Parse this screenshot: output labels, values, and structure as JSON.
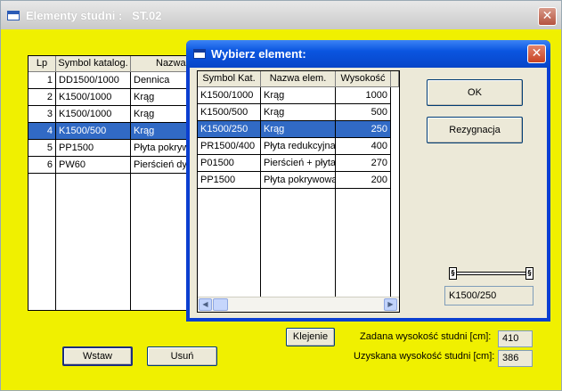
{
  "window": {
    "title": "Elementy studni :   ST.02",
    "close_glyph": "✕"
  },
  "main_table": {
    "columns": [
      "Lp",
      "Symbol katalog.",
      "Nazwa"
    ],
    "rows": [
      [
        "1",
        "DD1500/1000",
        "Dennica"
      ],
      [
        "2",
        "K1500/1000",
        "Krąg"
      ],
      [
        "3",
        "K1500/1000",
        "Krąg"
      ],
      [
        "4",
        "K1500/500",
        "Krąg"
      ],
      [
        "5",
        "PP1500",
        "Płyta pokryw"
      ],
      [
        "6",
        "PW60",
        "Pierścień dys"
      ]
    ],
    "selected_row": 3
  },
  "buttons": {
    "insert": "Wstaw",
    "delete": "Usuń",
    "glue": "Klejenie"
  },
  "heights": {
    "target_label": "Zadana wysokość studni [cm]:",
    "target_value": "410",
    "achieved_label": "Uzyskana wysokość studni [cm]:",
    "achieved_value": "386"
  },
  "dialog": {
    "title": "Wybierz element:",
    "close_glyph": "✕",
    "columns": [
      "Symbol Kat.",
      "Nazwa elem.",
      "Wysokość"
    ],
    "rows": [
      [
        "K1500/1000",
        "Krąg",
        "1000"
      ],
      [
        "K1500/500",
        "Krąg",
        "500"
      ],
      [
        "K1500/250",
        "Krąg",
        "250"
      ],
      [
        "PR1500/400",
        "Płyta redukcyjna",
        "400"
      ],
      [
        "P01500",
        "Pierścień + płyta",
        "270"
      ],
      [
        "PP1500",
        "Płyta pokrywowa",
        "200"
      ]
    ],
    "selected_row": 2,
    "ok_label": "OK",
    "cancel_label": "Rezygnacja",
    "selected_value": "K1500/250",
    "scroll_left_glyph": "◀",
    "scroll_right_glyph": "▶"
  }
}
